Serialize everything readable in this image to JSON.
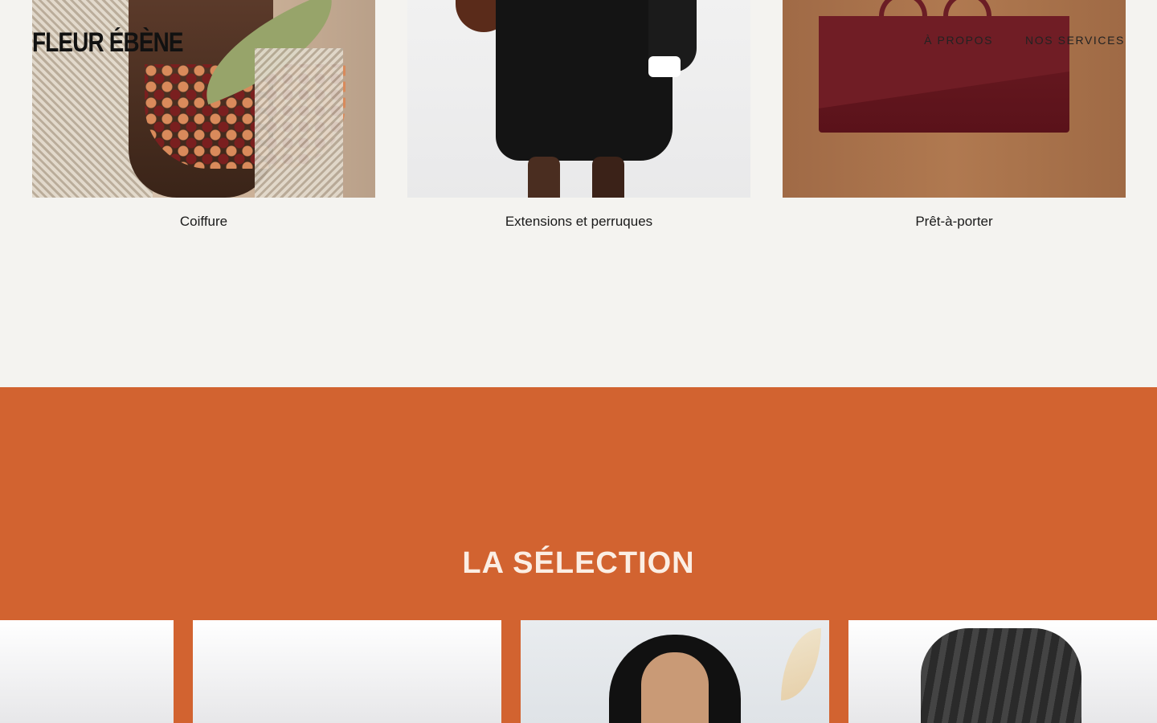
{
  "header": {
    "logo": "FLEUR ÉBÈNE",
    "nav": [
      {
        "label": "À PROPOS"
      },
      {
        "label": "NOS SERVICES"
      }
    ]
  },
  "categories": [
    {
      "label": "Coiffure"
    },
    {
      "label": "Extensions et perruques"
    },
    {
      "label": "Prêt-à-porter"
    }
  ],
  "selection": {
    "title": "LA SÉLECTION",
    "background_color": "#d26330"
  }
}
